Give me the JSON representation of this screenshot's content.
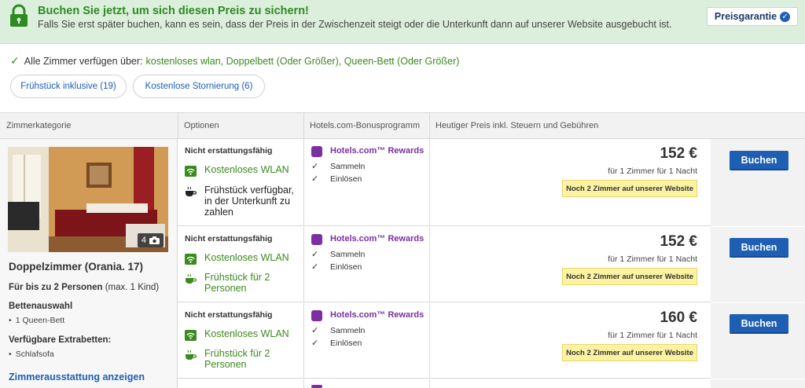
{
  "banner": {
    "title": "Buchen Sie jetzt, um sich diesen Preis zu sichern!",
    "subtitle": "Falls Sie erst später buchen, kann es sein, dass der Preis in der Zwischenzeit steigt oder die Unterkunft dann auf unserer Website ausgebucht ist.",
    "guarantee_label": "Preisgarantie"
  },
  "amenities": {
    "label": "Alle Zimmer verfügen über:",
    "value": "kostenloses wlan, Doppelbett (Oder Größer), Queen-Bett (Oder Größer)"
  },
  "filters": [
    {
      "label": "Frühstück inklusive (19)"
    },
    {
      "label": "Kostenlose Stornierung (6)"
    }
  ],
  "table_headers": {
    "category": "Zimmerkategorie",
    "options": "Optionen",
    "bonus": "Hotels.com-Bonusprogramm",
    "price": "Heutiger Preis inkl. Steuern und Gebühren"
  },
  "room": {
    "photo_count": "4",
    "name": "Doppelzimmer (Orania. 17)",
    "capacity_bold": "Für bis zu 2 Personen",
    "capacity_rest": "(max. 1 Kind)",
    "beds_heading": "Bettenauswahl",
    "beds_item": "1 Queen-Bett",
    "extra_heading": "Verfügbare Extrabetten:",
    "extra_item": "Schlafsofa",
    "details_link": "Zimmerausstattung anzeigen"
  },
  "rows": [
    {
      "policy": "Nicht erstattungsfähig",
      "wifi": "Kostenloses WLAN",
      "breakfast": "Frühstück verfügbar, in der Unterkunft zu zahlen",
      "rewards_title": "Hotels.com™ Rewards",
      "collect": "Sammeln",
      "redeem": "Einlösen",
      "price": "152 €",
      "price_sub": "für 1 Zimmer für 1 Nacht",
      "availability": "Noch 2 Zimmer auf unserer Website",
      "book_label": "Buchen"
    },
    {
      "policy": "Nicht erstattungsfähig",
      "wifi": "Kostenloses WLAN",
      "breakfast": "Frühstück für 2 Personen",
      "rewards_title": "Hotels.com™ Rewards",
      "collect": "Sammeln",
      "redeem": "Einlösen",
      "price": "152 €",
      "price_sub": "für 1 Zimmer für 1 Nacht",
      "availability": "Noch 2 Zimmer auf unserer Website",
      "book_label": "Buchen"
    },
    {
      "policy": "Nicht erstattungsfähig",
      "wifi": "Kostenloses WLAN",
      "breakfast": "Frühstück für 2 Personen",
      "rewards_title": "Hotels.com™ Rewards",
      "collect": "Sammeln",
      "redeem": "Einlösen",
      "price": "160 €",
      "price_sub": "für 1 Zimmer für 1 Nacht",
      "availability": "Noch 2 Zimmer auf unserer Website",
      "book_label": "Buchen"
    }
  ],
  "colors": {
    "banner_bg": "#dceedc",
    "accent_green": "#3b8a1e",
    "link_blue": "#1e5fb3",
    "rewards_purple": "#7b2fa1",
    "availability_bg": "#fcf3a2"
  }
}
